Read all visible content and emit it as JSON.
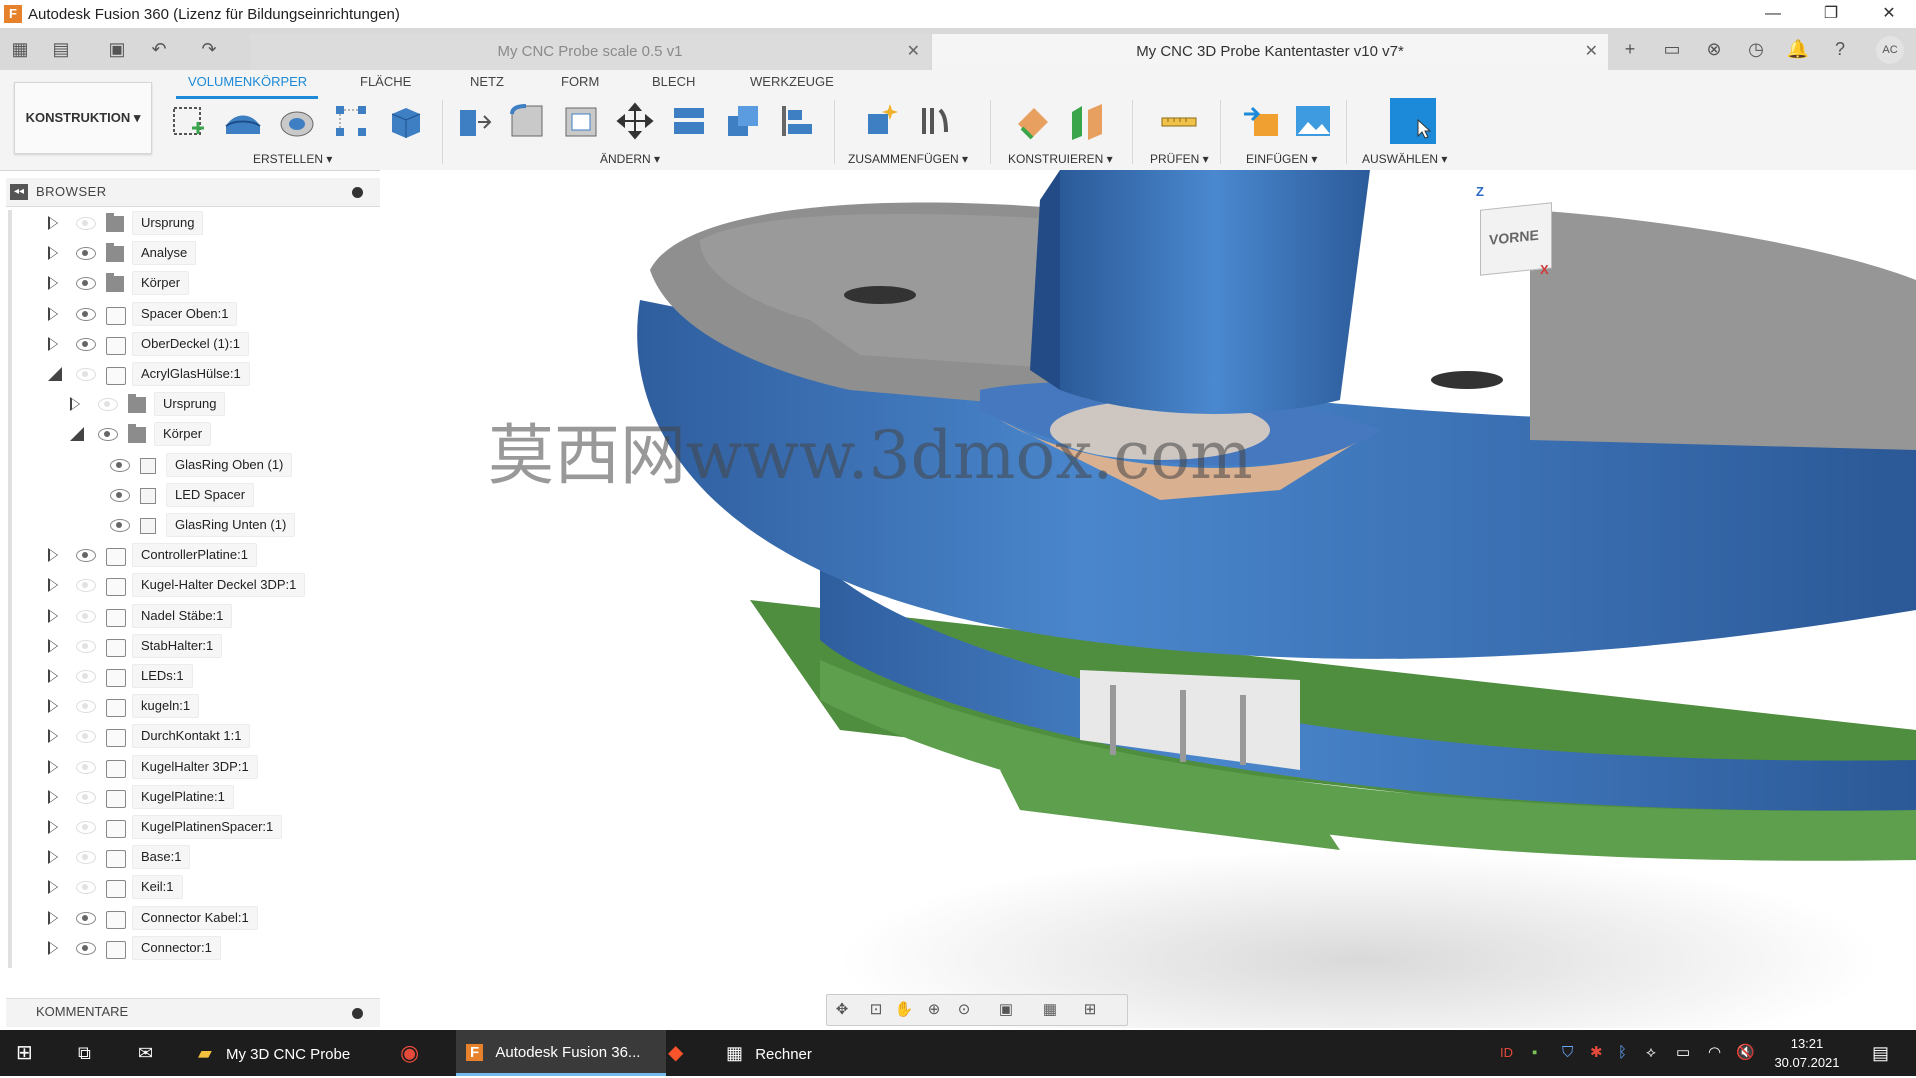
{
  "window": {
    "title": "Autodesk Fusion 360 (Lizenz für Bildungseinrichtungen)",
    "app_icon_letter": "F",
    "minimize": "—",
    "maximize": "❐",
    "close": "✕"
  },
  "tabs": [
    {
      "label": "My CNC Probe scale 0.5 v1",
      "active": false
    },
    {
      "label": "My CNC 3D Probe Kantentaster v10 v7*",
      "active": true
    }
  ],
  "user_initials": "AC",
  "workspace_label": "KONSTRUKTION ▾",
  "toolbar_tabs": [
    "VOLUMENKÖRPER",
    "FLÄCHE",
    "NETZ",
    "FORM",
    "BLECH",
    "WERKZEUGE"
  ],
  "toolbar_groups": [
    "ERSTELLEN ▾",
    "ÄNDERN ▾",
    "ZUSAMMENFÜGEN ▾",
    "KONSTRUIEREN ▾",
    "PRÜFEN ▾",
    "EINFÜGEN ▾",
    "AUSWÄHLEN ▾"
  ],
  "browser": {
    "title": "BROWSER",
    "items": [
      {
        "label": "Ursprung",
        "visible": false,
        "type": "folder",
        "level": 0,
        "expanded": false
      },
      {
        "label": "Analyse",
        "visible": true,
        "type": "folder",
        "level": 0,
        "expanded": false
      },
      {
        "label": "Körper",
        "visible": true,
        "type": "folder",
        "level": 0,
        "expanded": false
      },
      {
        "label": "Spacer Oben:1",
        "visible": true,
        "type": "comp",
        "level": 0,
        "expanded": false
      },
      {
        "label": "OberDeckel (1):1",
        "visible": true,
        "type": "comp",
        "level": 0,
        "expanded": false
      },
      {
        "label": "AcrylGlasHülse:1",
        "visible": false,
        "type": "comp",
        "level": 0,
        "expanded": true
      },
      {
        "label": "Ursprung",
        "visible": false,
        "type": "folder",
        "level": 1,
        "expanded": false
      },
      {
        "label": "Körper",
        "visible": true,
        "type": "folder",
        "level": 1,
        "expanded": true
      },
      {
        "label": "GlasRing Oben (1)",
        "visible": true,
        "type": "body",
        "level": 2,
        "expanded": null
      },
      {
        "label": "LED Spacer",
        "visible": true,
        "type": "body",
        "level": 2,
        "expanded": null
      },
      {
        "label": "GlasRing Unten (1)",
        "visible": true,
        "type": "body",
        "level": 2,
        "expanded": null
      },
      {
        "label": "ControllerPlatine:1",
        "visible": true,
        "type": "comp",
        "level": 0,
        "expanded": false
      },
      {
        "label": "Kugel-Halter Deckel 3DP:1",
        "visible": false,
        "type": "comp",
        "level": 0,
        "expanded": false
      },
      {
        "label": "Nadel Stäbe:1",
        "visible": false,
        "type": "comp",
        "level": 0,
        "expanded": false
      },
      {
        "label": "StabHalter:1",
        "visible": false,
        "type": "comp",
        "level": 0,
        "expanded": false
      },
      {
        "label": "LEDs:1",
        "visible": false,
        "type": "comp",
        "level": 0,
        "expanded": false
      },
      {
        "label": "kugeln:1",
        "visible": false,
        "type": "comp",
        "level": 0,
        "expanded": false
      },
      {
        "label": "DurchKontakt 1:1",
        "visible": false,
        "type": "comp",
        "level": 0,
        "expanded": false
      },
      {
        "label": "KugelHalter 3DP:1",
        "visible": false,
        "type": "comp",
        "level": 0,
        "expanded": false
      },
      {
        "label": "KugelPlatine:1",
        "visible": false,
        "type": "comp",
        "level": 0,
        "expanded": false
      },
      {
        "label": "KugelPlatinenSpacer:1",
        "visible": false,
        "type": "comp",
        "level": 0,
        "expanded": false
      },
      {
        "label": "Base:1",
        "visible": false,
        "type": "comp",
        "level": 0,
        "expanded": false
      },
      {
        "label": "Keil:1",
        "visible": false,
        "type": "comp",
        "level": 0,
        "expanded": false
      },
      {
        "label": "Connector Kabel:1",
        "visible": true,
        "type": "comp",
        "level": 0,
        "expanded": false
      },
      {
        "label": "Connector:1",
        "visible": true,
        "type": "comp",
        "level": 0,
        "expanded": false
      }
    ]
  },
  "comments_title": "KOMMENTARE",
  "viewcube": {
    "face": "VORNE",
    "axis_z": "Z",
    "axis_x": "X"
  },
  "watermark": "莫西网www.3dmox.com",
  "taskbar": {
    "apps": [
      {
        "label": "My 3D CNC Probe"
      },
      {
        "label": "Autodesk Fusion 36..."
      },
      {
        "label": "Rechner"
      }
    ],
    "time": "13:21",
    "date": "30.07.2021"
  },
  "colors": {
    "accent": "#1c8ad8",
    "model_blue": "#3e73b8",
    "model_gray": "#8c8c8c",
    "pcb_green": "#5a9a4a"
  }
}
